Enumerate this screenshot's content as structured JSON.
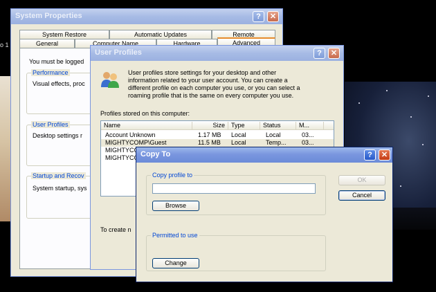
{
  "background": {
    "left_text": "o 1"
  },
  "system_properties": {
    "title": "System Properties",
    "tabs_row1": [
      "System Restore",
      "Automatic Updates",
      "Remote"
    ],
    "tabs_row2": [
      "General",
      "Computer Name",
      "Hardware",
      "Advanced"
    ],
    "logon_text": "You must be logged",
    "groups": [
      {
        "label": "Performance",
        "text": "Visual effects, proc"
      },
      {
        "label": "User Profiles",
        "text": "Desktop settings r"
      },
      {
        "label": "Startup and Recov",
        "text": "System startup, sys"
      }
    ]
  },
  "user_profiles": {
    "title": "User Profiles",
    "description": [
      "User profiles store settings for your desktop and other",
      "information related to your user account. You can create a",
      "different profile on each computer you use, or you can select a",
      "roaming profile that is the same on every computer you use."
    ],
    "list_label": "Profiles stored on this computer:",
    "columns": [
      "Name",
      "Size",
      "Type",
      "Status",
      "M..."
    ],
    "rows": [
      {
        "name": "Account Unknown",
        "size": "1.17 MB",
        "type": "Local",
        "status": "Local",
        "modified": "03..."
      },
      {
        "name": "MIGHTYCOMP\\Guest",
        "size": "11.5 MB",
        "type": "Local",
        "status": "Temp...",
        "modified": "03..."
      },
      {
        "name": "MIGHTYCO",
        "size": "",
        "type": "",
        "status": "",
        "modified": ""
      },
      {
        "name": "MIGHTYCO",
        "size": "",
        "type": "",
        "status": "",
        "modified": ""
      }
    ],
    "footer_text": "To create n"
  },
  "copy_to": {
    "title": "Copy To",
    "copy_profile_label": "Copy profile to",
    "copy_profile_value": "",
    "browse_label": "Browse",
    "permitted_label": "Permitted to use",
    "change_label": "Change",
    "ok_label": "OK",
    "cancel_label": "Cancel"
  }
}
